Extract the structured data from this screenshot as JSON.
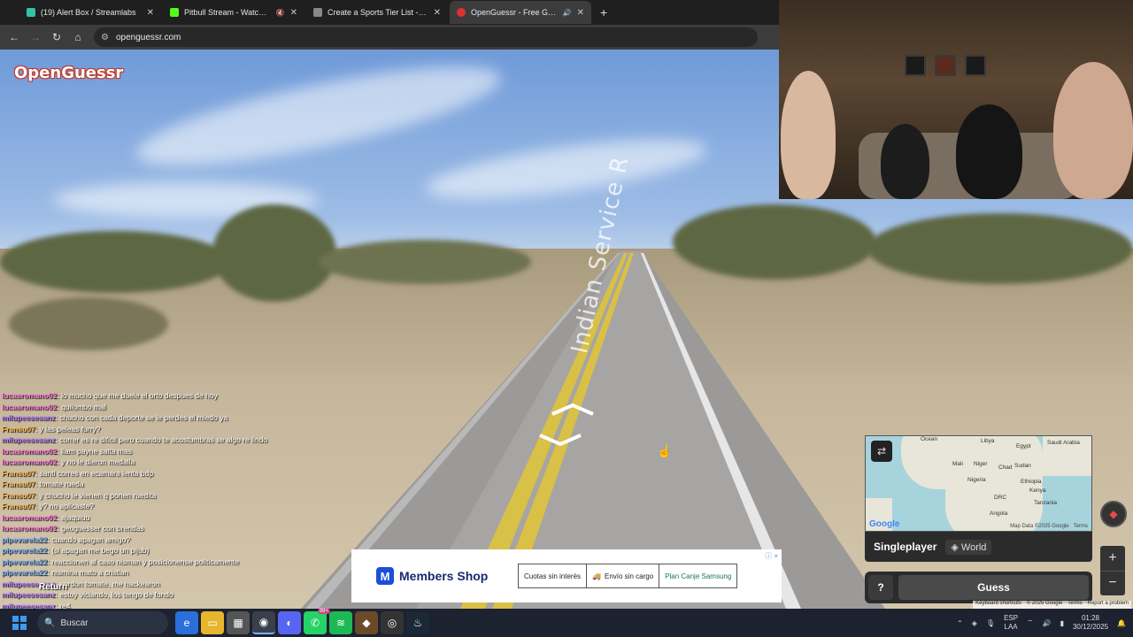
{
  "browser": {
    "tabs": [
      {
        "title": "(19) Alert Box / Streamlabs",
        "favicon_color": "#31c3a2",
        "active": false,
        "audio": ""
      },
      {
        "title": "Pitbull Stream - Watch Live",
        "favicon_color": "#53fc18",
        "active": false,
        "audio": "mute"
      },
      {
        "title": "Create a Sports Tier List - TierM",
        "favicon_color": "#888888",
        "active": false,
        "audio": ""
      },
      {
        "title": "OpenGuessr - Free GeoGue",
        "favicon_color": "#e03131",
        "active": true,
        "audio": "speaker"
      }
    ],
    "new_tab_label": "+",
    "url": "openguessr.com"
  },
  "game": {
    "logo": "OpenGuessr",
    "road_label": "Indian Service R",
    "mode": "Singleplayer",
    "map_scope": "World",
    "guess_label": "Guess",
    "help_label": "?",
    "zoom_in": "+",
    "zoom_out": "−"
  },
  "minimap": {
    "labels": {
      "ocean": "Ocean",
      "libya": "Libya",
      "egypt": "Egypt",
      "saudi": "Saudi Arabia",
      "mali": "Mali",
      "niger": "Niger",
      "sudan": "Sudan",
      "chad": "Chad",
      "ethiopia": "Ethiopia",
      "nigeria": "Nigeria",
      "kenya": "Kenya",
      "drc": "DRC",
      "tanzania": "Tanzania",
      "angola": "Angola"
    },
    "attribution": "Map Data ©2025 Google",
    "terms": "Terms",
    "google": "Google"
  },
  "footer_links": {
    "shortcuts": "Keyboard shortcuts",
    "copyright": "© 2025 Google",
    "terms": "Terms",
    "report": "Report a problem"
  },
  "chat": [
    {
      "user": "lucasromano02",
      "text": "lo mucho que me duele el orto despues de hoy",
      "color": "#ff7ad9"
    },
    {
      "user": "lucasromano02",
      "text": "quilombo mal",
      "color": "#ff7ad9"
    },
    {
      "user": "milupeesesanz",
      "text": "chucho con cada deporte se le perdes el miedo ya",
      "color": "#b77cff"
    },
    {
      "user": "Fransu07",
      "text": "y las peleas furry?",
      "color": "#ffb84d"
    },
    {
      "user": "milupeesesanz",
      "text": "correr es re dificil pero cuando te acostumbras se algo re lindo",
      "color": "#b77cff"
    },
    {
      "user": "lucasromano02",
      "text": "liam payne salta mas",
      "color": "#ff7ad9"
    },
    {
      "user": "lucasromano02",
      "text": "y no le dieron medalla",
      "color": "#ff7ad9"
    },
    {
      "user": "Fransu07",
      "text": "santi corres en ecamara lenta bdp",
      "color": "#ffb84d"
    },
    {
      "user": "Fransu07",
      "text": "tomate rueda",
      "color": "#ffb84d"
    },
    {
      "user": "Fransu07",
      "text": "y chucho le vienen q ponen ruedita",
      "color": "#ffb84d"
    },
    {
      "user": "Fransu07",
      "text": "y? no aplicaste?",
      "color": "#ffb84d"
    },
    {
      "user": "lucasromano02",
      "text": "ajaquiuu",
      "color": "#ff7ad9"
    },
    {
      "user": "lucasromano02",
      "text": "geoguesser con brendas",
      "color": "#ff7ad9"
    },
    {
      "user": "pipevarela22",
      "text": "cuando apagan amigo?",
      "color": "#7ab4ff"
    },
    {
      "user": "pipevarela22",
      "text": "(si apagan me bego un pijub)",
      "color": "#7ab4ff"
    },
    {
      "user": "pipevarela22",
      "text": "reaccionen al caso nisman y posicionense politicamente",
      "color": "#7ab4ff"
    },
    {
      "user": "pipevarela22",
      "text": "nismina mato a cristian",
      "color": "#7ab4ff"
    },
    {
      "user": "milupeesesanz",
      "text": "gordon tomate, me hackearon",
      "color": "#b77cff"
    },
    {
      "user": "milupeesesanz",
      "text": "estoy viciando, los tengo de fondo",
      "color": "#b77cff"
    },
    {
      "user": "milupeesesanz",
      "text": "re4",
      "color": "#b77cff"
    }
  ],
  "ad": {
    "brand": "Members Shop",
    "promo1": "Cuotas sin interés",
    "promo2": "Envío sin cargo",
    "promo3": "Plan Canje Samsung",
    "info": "ⓘ ×"
  },
  "return_label": "Return",
  "taskbar": {
    "search_placeholder": "Buscar",
    "badge": "99+",
    "lang_top": "ESP",
    "lang_bottom": "LAA",
    "time": "01:28",
    "date": "30/12/2025"
  },
  "colors": {
    "accent": "#e03131",
    "panel": "#2b2b2b"
  }
}
